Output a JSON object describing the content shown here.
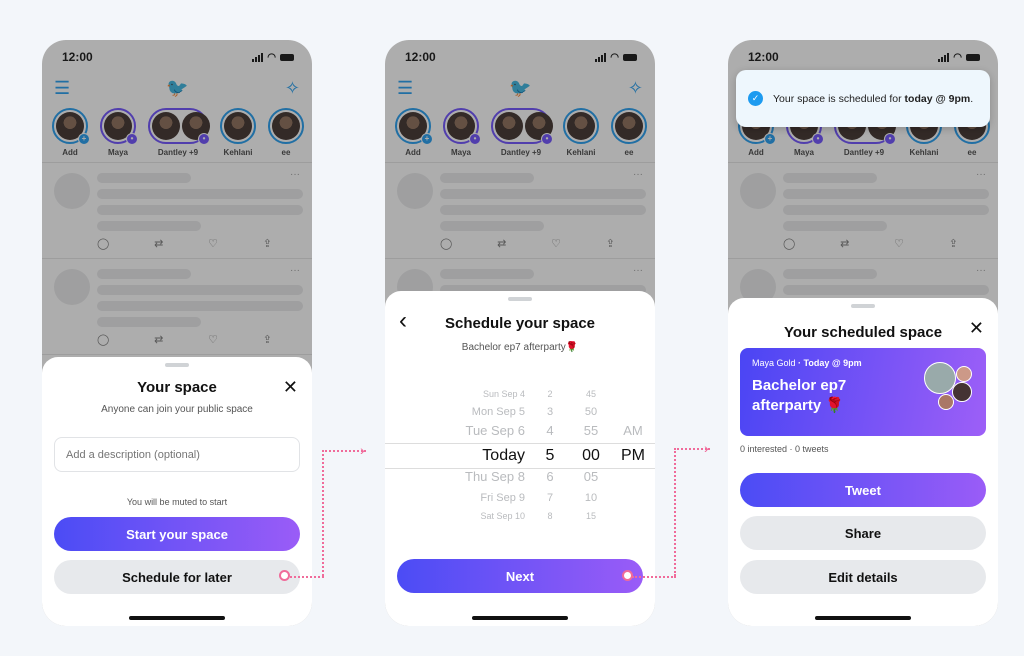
{
  "status_time": "12:00",
  "stories": [
    {
      "label": "Add",
      "ring": "blue",
      "badge": "+"
    },
    {
      "label": "Maya",
      "ring": "purple",
      "badge": "•"
    },
    {
      "label": "Dantley +9",
      "ring": "purple",
      "badge": "•",
      "wide": true
    },
    {
      "label": "Kehlani",
      "ring": "blue"
    },
    {
      "label": "ee",
      "ring": "blue"
    }
  ],
  "icons": {
    "menu": "☰",
    "logo": "🐦",
    "sparkle": "✧",
    "reply": "◯",
    "retweet": "⇄",
    "like": "♡",
    "share": "⇪",
    "more": "···",
    "close": "✕",
    "back": "‹",
    "check": "✓"
  },
  "colors": {
    "accent": "#1d9bf0",
    "gradient_start": "#4b4cf5",
    "gradient_end": "#9a5cf7",
    "connector": "#f06b9a"
  },
  "screen1": {
    "title": "Your space",
    "subtitle": "Anyone can join your public space",
    "description_placeholder": "Add a description (optional)",
    "muted_note": "You will be muted to start",
    "start_button": "Start your space",
    "schedule_button": "Schedule for later"
  },
  "screen2": {
    "title": "Schedule your space",
    "subtitle": "Bachelor ep7 afterparty🌹",
    "picker_rows": [
      [
        "Sun Sep 4",
        "2",
        "45",
        ""
      ],
      [
        "Mon Sep 5",
        "3",
        "50",
        ""
      ],
      [
        "Tue Sep 6",
        "4",
        "55",
        "AM"
      ],
      [
        "Today",
        "5",
        "00",
        "PM"
      ],
      [
        "Thu Sep 8",
        "6",
        "05",
        ""
      ],
      [
        "Fri Sep 9",
        "7",
        "10",
        ""
      ],
      [
        "Sat Sep 10",
        "8",
        "15",
        ""
      ]
    ],
    "next_button": "Next"
  },
  "screen3": {
    "toast_text": "Your space is scheduled for ",
    "toast_bold": "today @ 9pm",
    "toast_end": ".",
    "title": "Your scheduled space",
    "host": "Maya Gold",
    "when": " · Today @ 9pm",
    "space_title": "Bachelor ep7 afterparty 🌹",
    "stats": "0 interested · 0 tweets",
    "tweet_button": "Tweet",
    "share_button": "Share",
    "edit_button": "Edit details"
  }
}
